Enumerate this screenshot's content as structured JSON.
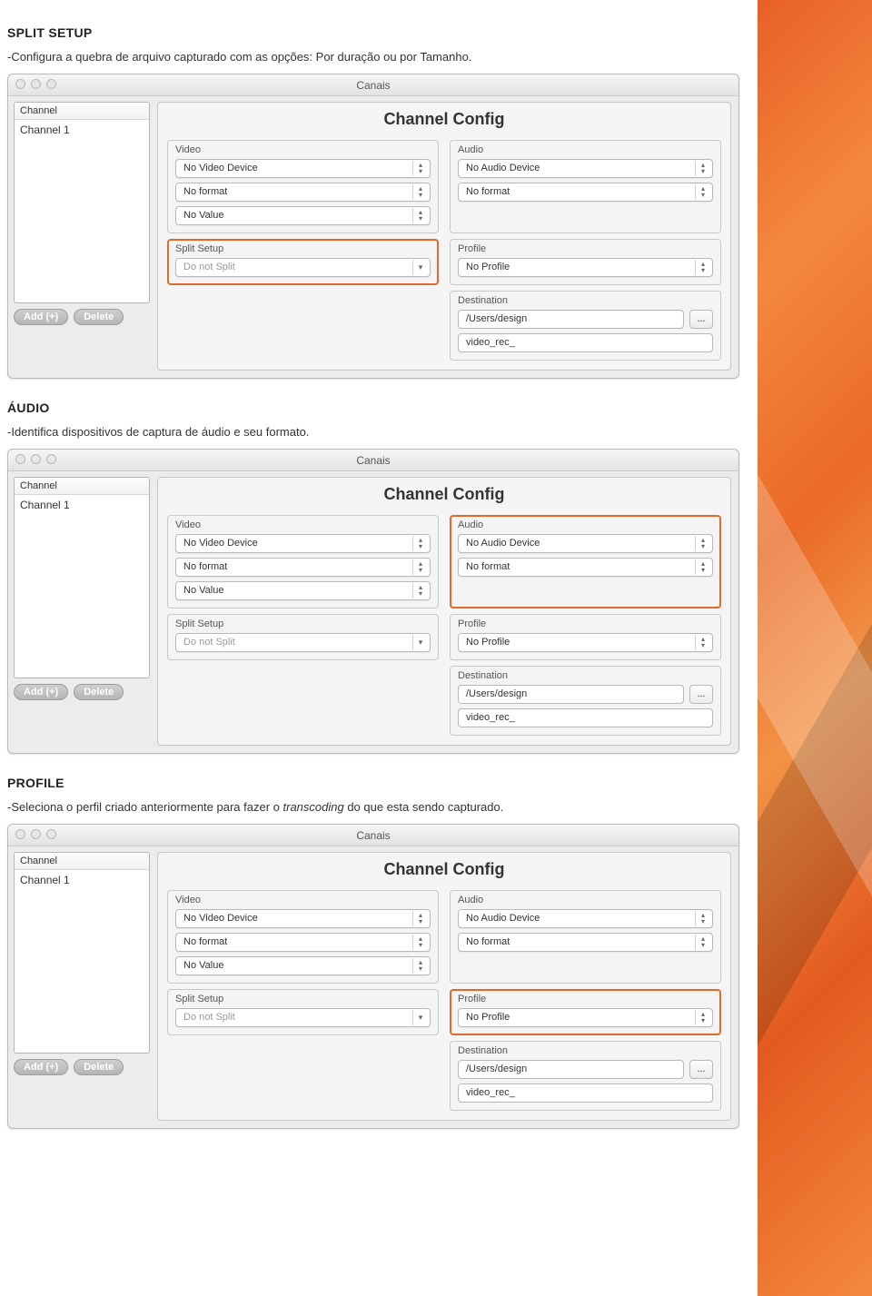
{
  "sections": {
    "split": {
      "heading": "SPLIT SETUP",
      "body_prefix": "-Configura a quebra de arquivo capturado com as opções: Por duração ou por Tamanho."
    },
    "audio": {
      "heading": "ÁUDIO",
      "body": "-Identifica dispositivos de captura de áudio e seu formato."
    },
    "profile": {
      "heading": "PROFILE",
      "body_prefix": "-Seleciona o perfil criado anteriormente para fazer o ",
      "body_italic": "transcoding",
      "body_suffix": " do que esta sendo capturado."
    }
  },
  "window": {
    "title": "Canais",
    "channel_header": "Channel",
    "channel_item": "Channel 1",
    "add_btn": "Add (+)",
    "delete_btn": "Delete",
    "config_title": "Channel Config",
    "video_label": "Video",
    "audio_label": "Audio",
    "split_label": "Split Setup",
    "profile_label": "Profile",
    "destination_label": "Destination",
    "video_device": "No Video Device",
    "video_format": "No format",
    "video_value": "No Value",
    "audio_device": "No Audio Device",
    "audio_format": "No format",
    "split_value": "Do not Split",
    "profile_value": "No Profile",
    "dest_path": "/Users/design",
    "dest_prefix": "video_rec_",
    "browse": "..."
  }
}
